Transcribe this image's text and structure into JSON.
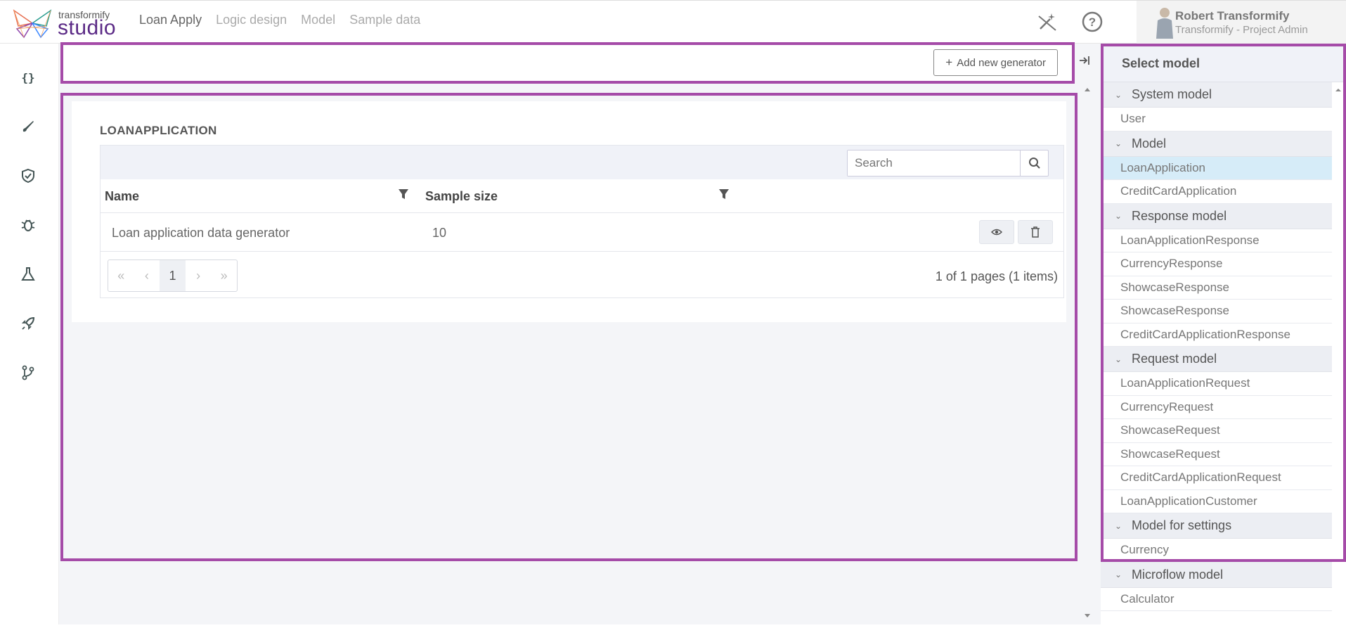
{
  "app": {
    "logo_small": "transformify",
    "logo_big": "studio"
  },
  "nav": {
    "items": [
      {
        "label": "Loan Apply",
        "active": true
      },
      {
        "label": "Logic design",
        "active": false
      },
      {
        "label": "Model",
        "active": false
      },
      {
        "label": "Sample data",
        "active": false
      }
    ]
  },
  "user": {
    "name": "Robert Transformify",
    "role": "Transformify - Project Admin"
  },
  "sidebar": {
    "icons": [
      "braces-icon",
      "brush-icon",
      "shield-check-icon",
      "bug-icon",
      "flask-icon",
      "rocket-icon",
      "git-branch-icon"
    ]
  },
  "toolbar": {
    "add_label": "Add new generator"
  },
  "main": {
    "section_title": "LOANAPPLICATION",
    "search_placeholder": "Search",
    "columns": [
      "Name",
      "Sample size"
    ],
    "rows": [
      {
        "name": "Loan application data generator",
        "size": "10"
      }
    ],
    "pager": {
      "current": "1",
      "info": "1 of 1 pages (1 items)"
    }
  },
  "right_panel": {
    "title": "Select model",
    "groups": [
      {
        "label": "System model",
        "items": [
          "User"
        ]
      },
      {
        "label": "Model",
        "items": [
          "LoanApplication",
          "CreditCardApplication"
        ]
      },
      {
        "label": "Response model",
        "items": [
          "LoanApplicationResponse",
          "CurrencyResponse",
          "ShowcaseResponse",
          "ShowcaseResponse",
          "CreditCardApplicationResponse"
        ]
      },
      {
        "label": "Request model",
        "items": [
          "LoanApplicationRequest",
          "CurrencyRequest",
          "ShowcaseRequest",
          "ShowcaseRequest",
          "CreditCardApplicationRequest",
          "LoanApplicationCustomer"
        ]
      },
      {
        "label": "Model for settings",
        "items": [
          "Currency"
        ]
      },
      {
        "label": "Microflow model",
        "items": [
          "Calculator"
        ]
      }
    ],
    "selected": "LoanApplication"
  },
  "colors": {
    "accent_outline": "#a54ba8",
    "brand": "#5b2a86",
    "selected_bg": "#d6ecf8"
  }
}
